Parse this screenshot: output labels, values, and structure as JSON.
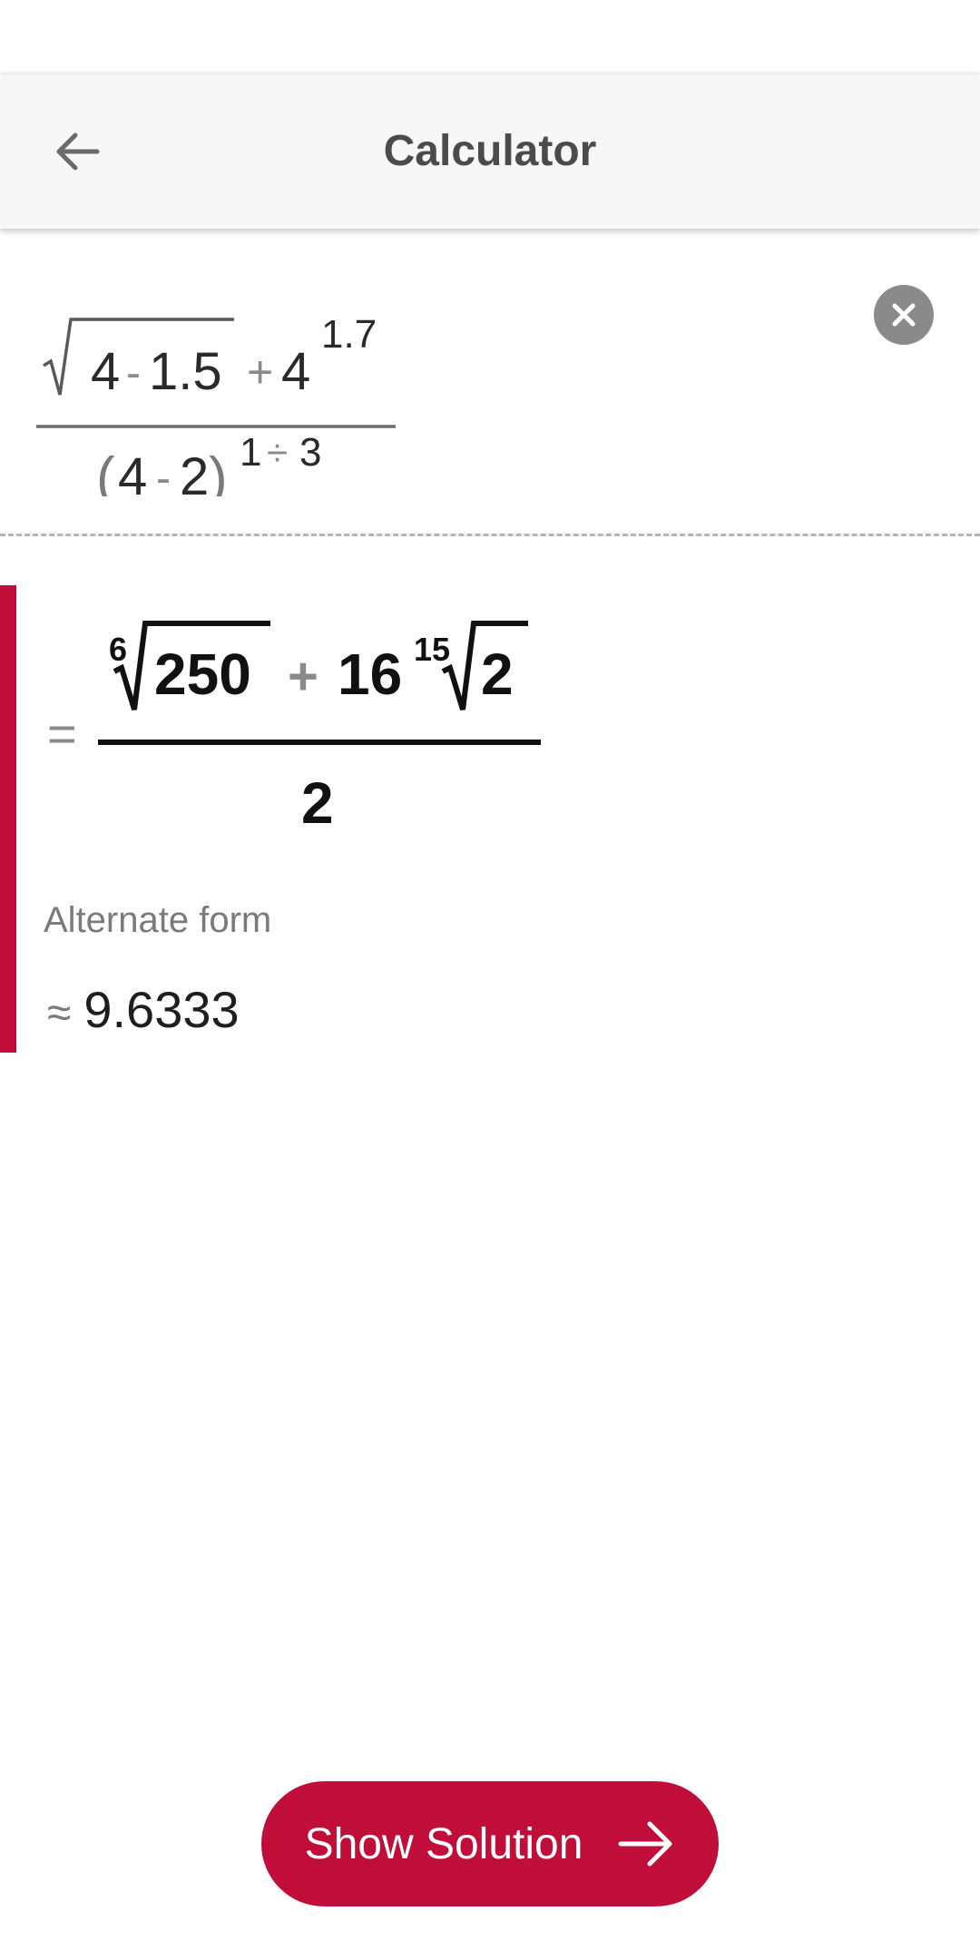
{
  "appbar": {
    "title": "Calculator",
    "back_icon": "arrow-left-icon"
  },
  "input_expression": {
    "radicand": [
      "4",
      "-",
      "1.5"
    ],
    "plus": "+",
    "base": "4",
    "exponent": "1.7",
    "denominator": [
      "(",
      "4",
      "-",
      "2",
      ")"
    ],
    "denominator_exponent": [
      "1",
      "÷",
      "3"
    ],
    "clear_icon": "close-circle-icon"
  },
  "result": {
    "equals": "=",
    "root1_index": "6",
    "root1_radicand": "250",
    "plus": "+",
    "coefficient": "16",
    "root2_index": "15",
    "root2_radicand": "2",
    "denominator": "2"
  },
  "alternate": {
    "label": "Alternate form",
    "approx_symbol": "≈",
    "value": "9.6333"
  },
  "footer": {
    "button_label": "Show Solution",
    "button_icon": "arrow-right-icon"
  },
  "colors": {
    "accent": "#c10d3a",
    "appbar_bg": "#f7f7f7"
  }
}
